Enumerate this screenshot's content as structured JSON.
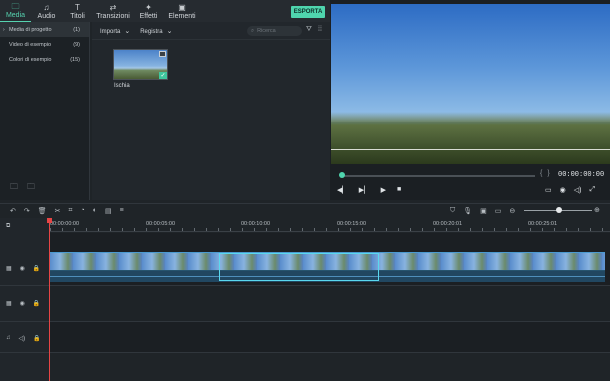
{
  "tabs": [
    {
      "label": "Media",
      "icon": "folder-icon",
      "glyph": "🗀",
      "active": true
    },
    {
      "label": "Audio",
      "icon": "music-note-icon",
      "glyph": "♫",
      "active": false
    },
    {
      "label": "Titoli",
      "icon": "text-icon",
      "glyph": "T",
      "active": false
    },
    {
      "label": "Transizioni",
      "icon": "transition-icon",
      "glyph": "⇄",
      "active": false
    },
    {
      "label": "Effetti",
      "icon": "effects-icon",
      "glyph": "✦",
      "active": false
    },
    {
      "label": "Elementi",
      "icon": "image-icon",
      "glyph": "▣",
      "active": false
    }
  ],
  "export_label": "ESPORTA",
  "sidebar": {
    "items": [
      {
        "label": "Media di progetto",
        "count": "(1)",
        "active": true
      },
      {
        "label": "Video di esempio",
        "count": "(9)",
        "active": false
      },
      {
        "label": "Colori di esempio",
        "count": "(15)",
        "active": false
      }
    ]
  },
  "browser": {
    "import_label": "Importa",
    "record_label": "Registra",
    "search_placeholder": "Ricerca",
    "media_item_label": "Ischia"
  },
  "preview": {
    "timecode": "00:00:00:00"
  },
  "ruler": {
    "labels": [
      "00:00:00:00",
      "00:00:05:00",
      "00:00:10:00",
      "00:00:15:00",
      "00:00:20:01",
      "00:00:25:01"
    ]
  },
  "colors": {
    "accent": "#4fd5ae",
    "playhead": "#e64545",
    "selection": "#5ad8ee"
  }
}
